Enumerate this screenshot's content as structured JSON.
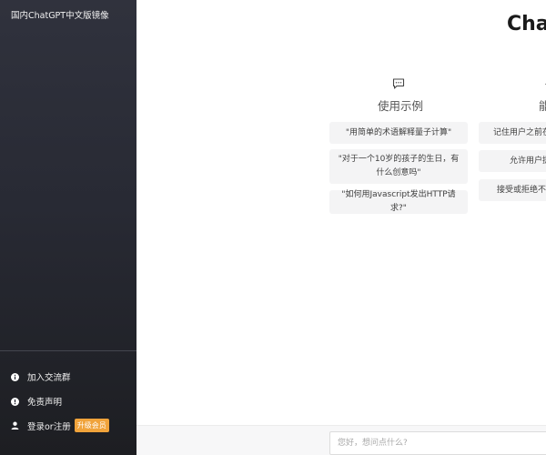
{
  "sidebar": {
    "brand": "国内ChatGPT中文版镜像",
    "items": [
      {
        "label": "加入交流群",
        "icon": "info-icon"
      },
      {
        "label": "免责声明",
        "icon": "alert-icon"
      },
      {
        "label": "登录or注册",
        "icon": "user-icon",
        "badge": "升级会员"
      }
    ],
    "badge_color": "#f0a33b"
  },
  "main": {
    "title": "Chat",
    "columns": [
      {
        "title": "使用示例",
        "icon": "chat-bubble-icon",
        "cards": [
          "\"用简单的术语解释量子计算\"",
          "\"对于一个10岁的孩子的生日，有什么创意吗\"",
          "\"如何用Javascript发出HTTP请求?\""
        ]
      },
      {
        "title": "能",
        "icon": "lightning-icon",
        "cards": [
          "记住用户之前在",
          "允许用户提",
          "接受或拒绝不"
        ]
      }
    ]
  },
  "input": {
    "placeholder": "您好，想问点什么?",
    "value": ""
  }
}
